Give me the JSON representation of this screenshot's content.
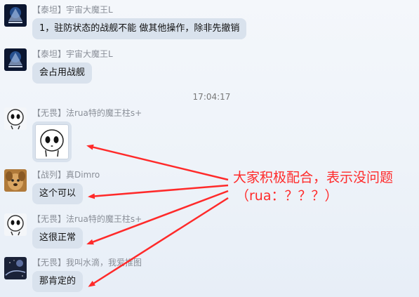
{
  "messages": [
    {
      "id": "m1",
      "sender": "【泰坦】宇宙大魔王L",
      "text": "1，驻防状态的战舰不能 做其他操作，除非先撤销",
      "avatar": "galaxy-avatar"
    },
    {
      "id": "m2",
      "sender": "【泰坦】宇宙大魔王L",
      "text": "会占用战舰",
      "avatar": "galaxy-avatar"
    },
    {
      "id": "m3",
      "sender": "【无畏】法rua特的魔王柱s+",
      "type": "image",
      "image": "skull-face-sticker",
      "avatar": "skull-avatar"
    },
    {
      "id": "m4",
      "sender": "【战列】真Dimro",
      "text": "这个可以",
      "avatar": "dog-avatar"
    },
    {
      "id": "m5",
      "sender": "【无畏】法rua特的魔王柱s+",
      "text": "这很正常",
      "avatar": "skull-avatar"
    },
    {
      "id": "m6",
      "sender": "【无畏】我叫水滴，我爱推图",
      "text": "那肯定的",
      "avatar": "space-avatar"
    }
  ],
  "timestamp": "17:04:17",
  "annotation": {
    "line1": "大家积极配合，表示没问题",
    "line2": "（rua：？？？）",
    "color": "#ff2a2a"
  },
  "colors": {
    "bubble": "#d9e2ed",
    "sender": "#8a8f98",
    "background": "#eef3f9"
  }
}
